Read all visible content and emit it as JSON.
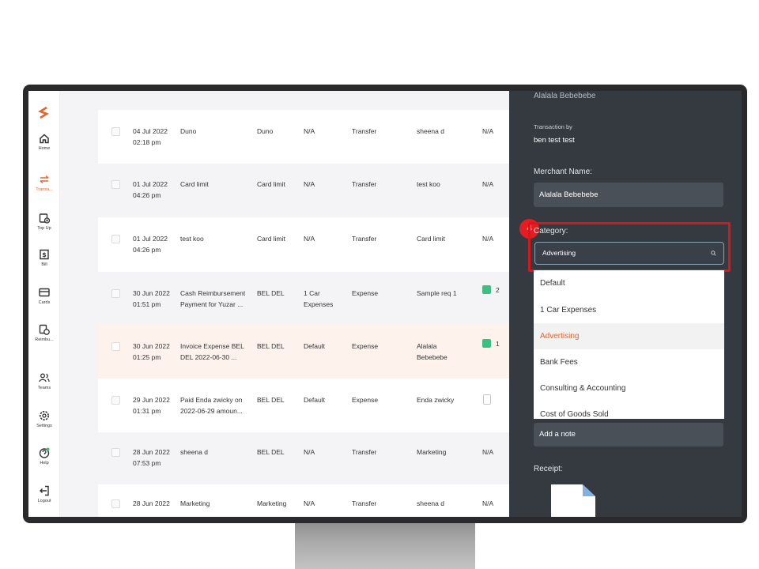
{
  "nav": {
    "items": [
      {
        "label": "Home",
        "icon": "home-icon"
      },
      {
        "label": "Transa...",
        "icon": "transfer-icon",
        "active": true
      },
      {
        "label": "Top Up",
        "icon": "top-up-icon"
      },
      {
        "label": "Bill",
        "icon": "bill-icon"
      },
      {
        "label": "Cards",
        "icon": "card-icon"
      },
      {
        "label": "Reimbu...",
        "icon": "reimburse-icon"
      },
      {
        "label": "Teams",
        "icon": "teams-icon"
      },
      {
        "label": "Settings",
        "icon": "settings-icon"
      },
      {
        "label": "Help",
        "icon": "help-icon"
      },
      {
        "label": "Logout",
        "icon": "logout-icon"
      }
    ],
    "accent": "#e8632b"
  },
  "transactions": [
    {
      "date": "04 Jul 2022",
      "time": "02:18 pm",
      "desc1": "Duno",
      "desc2": "",
      "from": "Duno",
      "cat1": "N/A",
      "cat2": "",
      "type": "Transfer",
      "to": "sheena d",
      "to2": "",
      "receipt": "N/A"
    },
    {
      "date": "01 Jul 2022",
      "time": "04:26 pm",
      "desc1": "Card limit",
      "desc2": "",
      "from": "Card limit",
      "cat1": "N/A",
      "cat2": "",
      "type": "Transfer",
      "to": "test koo",
      "to2": "",
      "receipt": "N/A"
    },
    {
      "date": "01 Jul 2022",
      "time": "04:26 pm",
      "desc1": "test koo",
      "desc2": "",
      "from": "Card limit",
      "cat1": "N/A",
      "cat2": "",
      "type": "Transfer",
      "to": "Card limit",
      "to2": "",
      "receipt": "N/A"
    },
    {
      "date": "30 Jun 2022",
      "time": "01:51 pm",
      "desc1": "Cash Reimbursement",
      "desc2": "Payment for Yuzar ...",
      "from": "BEL DEL",
      "cat1": "1 Car",
      "cat2": "Expenses",
      "type": "Expense",
      "to": "Sample req 1",
      "to2": "",
      "receipt_count": "2"
    },
    {
      "date": "30 Jun 2022",
      "time": "01:25 pm",
      "desc1": "Invoice Expense BEL",
      "desc2": "DEL 2022-06-30 ...",
      "from": "BEL DEL",
      "cat1": "Default",
      "cat2": "",
      "type": "Expense",
      "to": "Alalala",
      "to2": "Bebebebe",
      "receipt_count": "1"
    },
    {
      "date": "29 Jun 2022",
      "time": "01:31 pm",
      "desc1": "Paid Enda zwicky on",
      "desc2": "2022-06-29 amoun...",
      "from": "BEL DEL",
      "cat1": "Default",
      "cat2": "",
      "type": "Expense",
      "to": "Enda zwicky",
      "to2": ""
    },
    {
      "date": "28 Jun 2022",
      "time": "07:53 pm",
      "desc1": "sheena d",
      "desc2": "",
      "from": "BEL DEL",
      "cat1": "N/A",
      "cat2": "",
      "type": "Transfer",
      "to": "Marketing",
      "to2": "",
      "receipt": "N/A"
    },
    {
      "date": "28 Jun 2022",
      "time": "",
      "desc1": "Marketing",
      "desc2": "",
      "from": "Marketing",
      "cat1": "N/A",
      "cat2": "",
      "type": "Transfer",
      "to": "sheena d",
      "to2": "",
      "receipt": "N/A"
    }
  ],
  "panel": {
    "top_cut": "Alalala Bebebebe",
    "transaction_by_label": "Transaction by",
    "transaction_by_value": "ben test test",
    "merchant_label": "Merchant Name:",
    "merchant_value": "Alalala Bebebebe",
    "category_label": "Category:",
    "category_value": "Advertising",
    "step_number": "4",
    "dropdown_options": [
      "Default",
      "1 Car Expenses",
      "Advertising",
      "Bank Fees",
      "Consulting & Accounting",
      "Cost of Goods Sold"
    ],
    "selected_option": "Advertising",
    "note_placeholder": "Add a note",
    "receipt_label": "Receipt:"
  }
}
